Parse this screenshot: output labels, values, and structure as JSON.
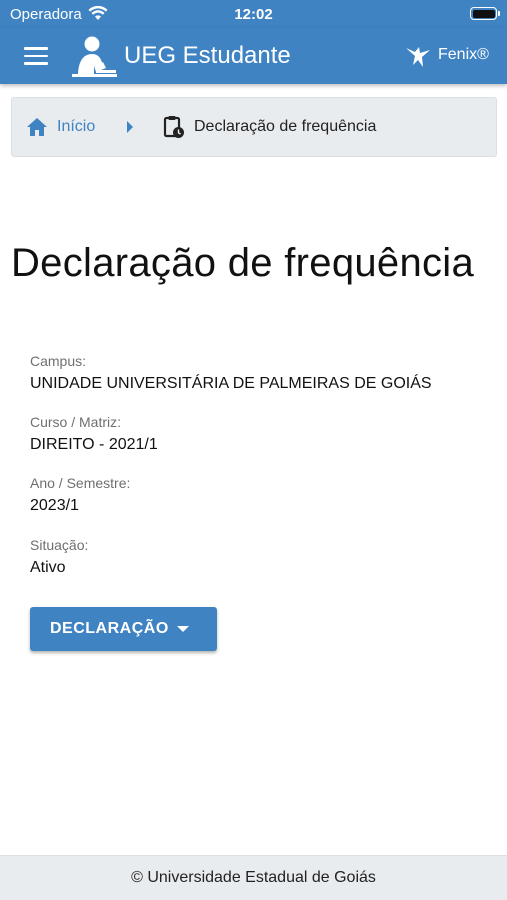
{
  "status_bar": {
    "carrier": "Operadora",
    "time": "12:02"
  },
  "app_bar": {
    "title": "UEG Estudante",
    "partner_label": "Fenix®"
  },
  "breadcrumb": {
    "home_label": "Início",
    "current_label": "Declaração de frequência"
  },
  "page": {
    "title": "Declaração de frequência"
  },
  "fields": {
    "campus": {
      "label": "Campus:",
      "value": "UNIDADE UNIVERSITÁRIA DE PALMEIRAS DE GOIÁS"
    },
    "curso": {
      "label": "Curso / Matriz:",
      "value": "DIREITO - 2021/1"
    },
    "ano": {
      "label": "Ano / Semestre:",
      "value": "2023/1"
    },
    "situacao": {
      "label": "Situação:",
      "value": "Ativo"
    }
  },
  "actions": {
    "declaration_label": "DECLARAÇÃO"
  },
  "footer": {
    "text": "© Universidade Estadual de Goiás"
  },
  "colors": {
    "primary": "#3f83c3",
    "breadcrumb_bg": "#e9ecef",
    "footer_bg": "#e9ecef"
  }
}
